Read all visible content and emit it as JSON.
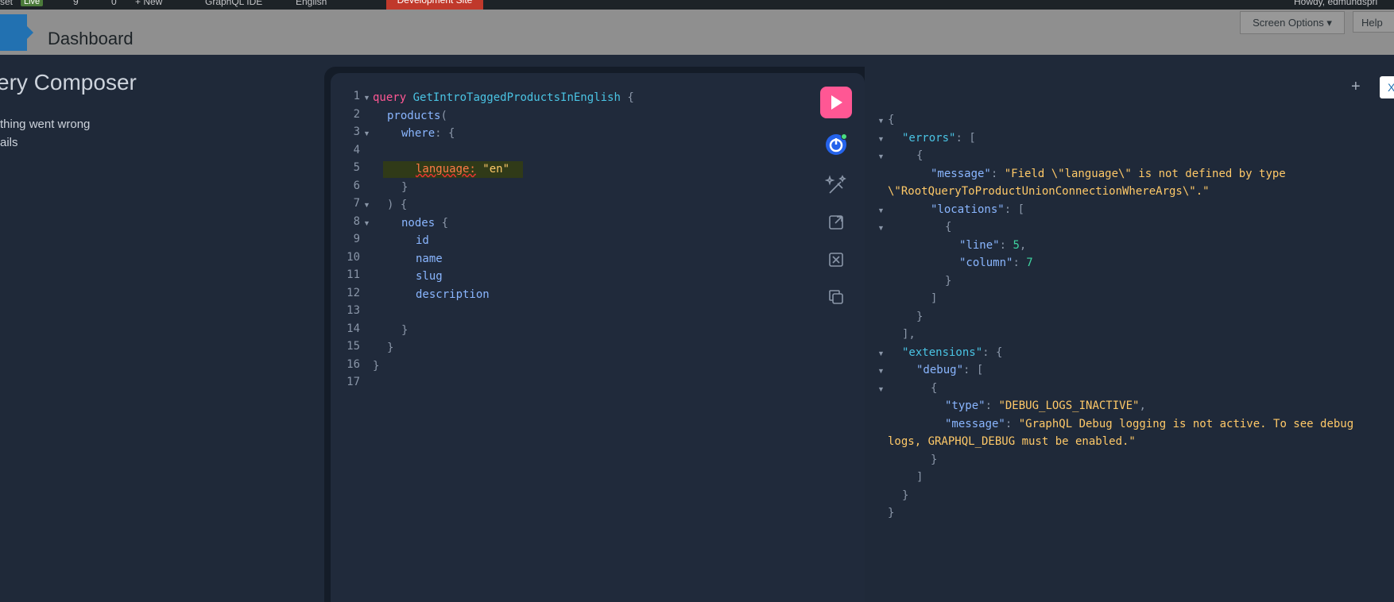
{
  "admin_bar": {
    "items": [
      "set",
      "Live",
      "9",
      "0",
      "+ New",
      "GraphQL IDE",
      "English",
      "Development Site",
      "Howdy, edmundspri"
    ]
  },
  "header": {
    "page_title": "Dashboard",
    "screen_options": "Screen Options ▾",
    "help": "Help"
  },
  "left_panel": {
    "title": "ery Composer",
    "error_line1": "thing went wrong",
    "error_line2": "ails"
  },
  "editor": {
    "line_numbers": [
      "1",
      "2",
      "3",
      "4",
      "5",
      "6",
      "7",
      "8",
      "9",
      "10",
      "11",
      "12",
      "13",
      "14",
      "15",
      "16",
      "17"
    ],
    "query_keyword": "query",
    "query_name": "GetIntroTaggedProductsInEnglish",
    "field_products": "products",
    "field_where": "where",
    "arg_language": "language:",
    "arg_language_value": "\"en\"",
    "field_nodes": "nodes",
    "field_id": "id",
    "field_name": "name",
    "field_slug": "slug",
    "field_description": "description"
  },
  "toolbar": {
    "run_icon": "play-icon",
    "icons": [
      "power-icon",
      "prettify-icon",
      "merge-icon",
      "copy-icon"
    ]
  },
  "results": {
    "errors_key": "\"errors\"",
    "message_key": "\"message\"",
    "error_message_part1": "\"Field \\\"language\\\" is not defined by type",
    "error_message_part2": "\\\"RootQueryToProductUnionConnectionWhereArgs\\\".\"",
    "locations_key": "\"locations\"",
    "line_key": "\"line\"",
    "line_value": "5",
    "column_key": "\"column\"",
    "column_value": "7",
    "extensions_key": "\"extensions\"",
    "debug_key": "\"debug\"",
    "type_key": "\"type\"",
    "type_value": "\"DEBUG_LOGS_INACTIVE\"",
    "debug_message_part1": "\"GraphQL Debug logging is not active. To see debug",
    "debug_message_part2": "logs, GRAPHQL_DEBUG must be enabled.\""
  },
  "results_toolbar": {
    "add_tab": "+",
    "close": "X"
  }
}
